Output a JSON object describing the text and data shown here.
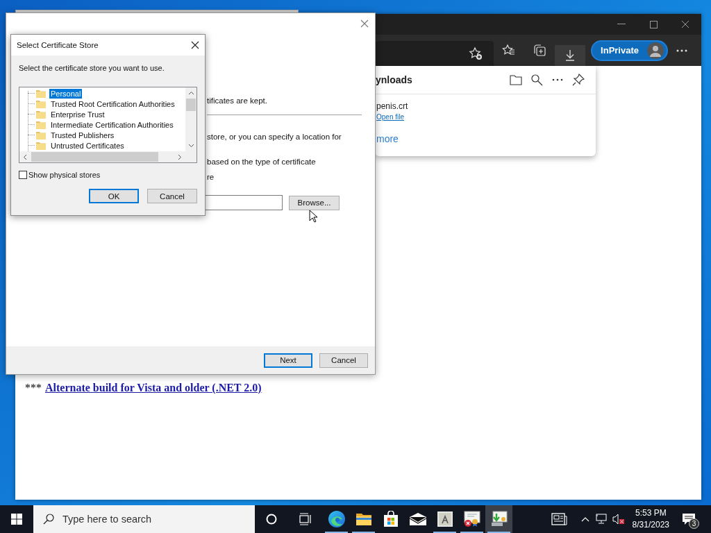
{
  "browser": {
    "toolbar_buttons": [
      {
        "kind": "add-favorite",
        "selected": false
      },
      {
        "kind": "favorites",
        "selected": false
      },
      {
        "kind": "collections",
        "selected": false
      },
      {
        "kind": "downloads",
        "selected": true
      }
    ],
    "inprivate_label": "InPrivate",
    "link_prefix": "***",
    "page_link": "Alternate build for Vista and older (.NET 2.0)"
  },
  "downloads_panel": {
    "title": "ynloads",
    "file_name": "penis.crt",
    "open_link": "Open file",
    "see_more": "more"
  },
  "wizard": {
    "separator_above": "tificates are kept.",
    "lines": [
      "store, or you can specify a location for",
      "based on the type of certificate",
      "re"
    ],
    "browse_button": "Browse...",
    "buttons": [
      {
        "label": "Next",
        "default": true
      },
      {
        "label": "Cancel",
        "default": false
      }
    ]
  },
  "dialog": {
    "title": "Select Certificate Store",
    "prompt": "Select the certificate store you want to use.",
    "stores": [
      {
        "label": "Personal",
        "selected": true
      },
      {
        "label": "Trusted Root Certification Authorities",
        "selected": false
      },
      {
        "label": "Enterprise Trust",
        "selected": false
      },
      {
        "label": "Intermediate Certification Authorities",
        "selected": false
      },
      {
        "label": "Trusted Publishers",
        "selected": false
      },
      {
        "label": "Untrusted Certificates",
        "selected": false
      }
    ],
    "show_physical": {
      "label": "Show physical stores",
      "checked": false
    },
    "buttons": [
      {
        "label": "OK",
        "default": true
      },
      {
        "label": "Cancel",
        "default": false
      }
    ]
  },
  "taskbar": {
    "search_placeholder": "Type here to search",
    "apps": [
      {
        "kind": "edge",
        "running": true,
        "selected": false
      },
      {
        "kind": "explorer",
        "running": true,
        "selected": false
      },
      {
        "kind": "store",
        "running": false,
        "selected": false
      },
      {
        "kind": "mail",
        "running": false,
        "selected": false
      },
      {
        "kind": "app",
        "running": true,
        "selected": false
      },
      {
        "kind": "cert-error",
        "running": true,
        "selected": false
      },
      {
        "kind": "cert-install",
        "running": true,
        "selected": true
      }
    ],
    "time": "5:53 PM",
    "date": "8/31/2023",
    "notification_count": "3"
  }
}
